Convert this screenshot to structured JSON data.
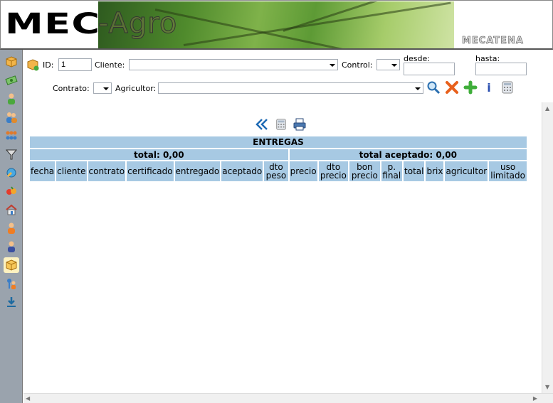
{
  "header": {
    "logo_left": "MEC",
    "logo_banner": "-Agro",
    "brand": "MECATENA"
  },
  "filters": {
    "id_label": "ID:",
    "id_value": "1",
    "cliente_label": "Cliente:",
    "cliente_value": "",
    "control_label": "Control:",
    "control_value": "",
    "desde_label": "desde:",
    "desde_value": "",
    "hasta_label": "hasta:",
    "hasta_value": "",
    "contrato_label": "Contrato:",
    "contrato_value": "",
    "agricultor_label": "Agricultor:",
    "agricultor_value": ""
  },
  "info_symbol": "i",
  "table": {
    "title": "ENTREGAS",
    "total_label": "total: 0,00",
    "total_aceptado_label": "total aceptado: 0,00",
    "columns": [
      "fecha",
      "cliente",
      "contrato",
      "certificado",
      "entregado",
      "aceptado",
      "dto peso",
      "precio",
      "dto precio",
      "bon precio",
      "p. final",
      "total",
      "brix",
      "agricultor",
      "uso limitado"
    ]
  },
  "sidebar_icons": [
    "box-add-icon",
    "money-icon",
    "user-green-icon",
    "users-icon",
    "group-icon",
    "filter-icon",
    "paint-icon",
    "fruit-icon",
    "house-icon",
    "person-orange-icon",
    "person-blue-icon",
    "box-icon",
    "pin-user-icon",
    "download-icon"
  ],
  "colors": {
    "header_bar": "#a7c9e3",
    "sidebar": "#9aa3ad"
  }
}
